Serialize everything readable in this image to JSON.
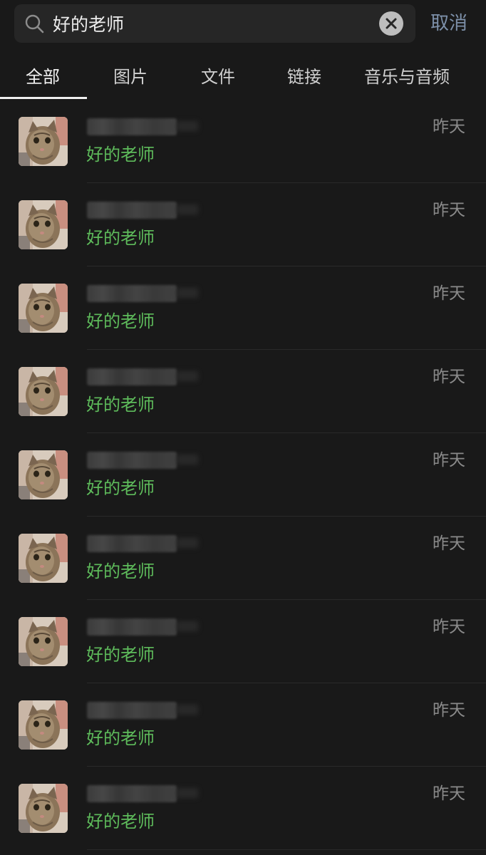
{
  "search": {
    "query": "好的老师",
    "cancel_label": "取消"
  },
  "tabs": [
    {
      "label": "全部",
      "active": true
    },
    {
      "label": "图片",
      "active": false
    },
    {
      "label": "文件",
      "active": false
    },
    {
      "label": "链接",
      "active": false
    },
    {
      "label": "音乐与音频",
      "active": false
    }
  ],
  "results": [
    {
      "snippet": "好的老师",
      "time": "昨天"
    },
    {
      "snippet": "好的老师",
      "time": "昨天"
    },
    {
      "snippet": "好的老师",
      "time": "昨天"
    },
    {
      "snippet": "好的老师",
      "time": "昨天"
    },
    {
      "snippet": "好的老师",
      "time": "昨天"
    },
    {
      "snippet": "好的老师",
      "time": "昨天"
    },
    {
      "snippet": "好的老师",
      "time": "昨天"
    },
    {
      "snippet": "好的老师",
      "time": "昨天"
    },
    {
      "snippet": "好的老师",
      "time": "昨天"
    }
  ],
  "colors": {
    "background": "#191919",
    "search_box": "#262626",
    "accent_cancel": "#7d90a9",
    "highlight_green": "#5ebb5b",
    "time_gray": "#8a8a8a"
  },
  "icons": {
    "search": "search-icon",
    "clear": "clear-icon",
    "avatar": "cat-avatar"
  }
}
